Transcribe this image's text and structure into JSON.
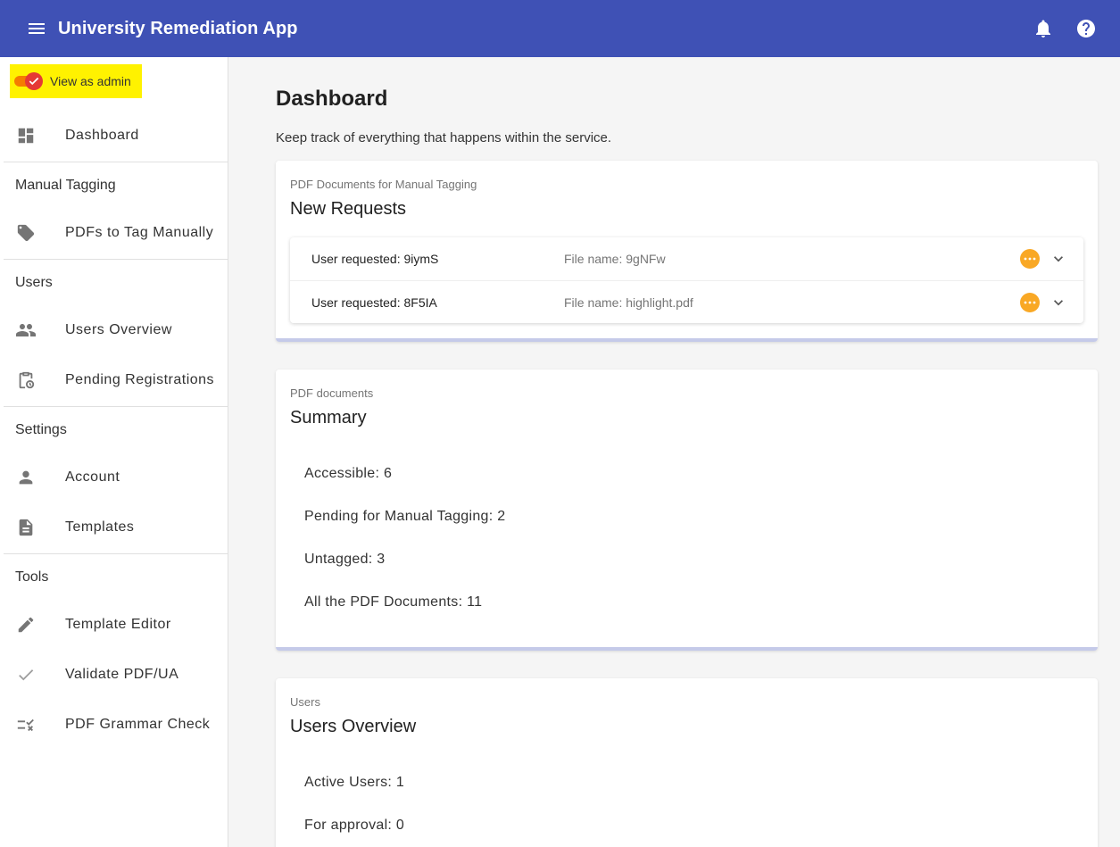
{
  "appbar": {
    "title": "University Remediation App",
    "menu_icon": "menu-icon",
    "notifications_icon": "bell-icon",
    "help_icon": "help-icon",
    "color": "#3f51b5"
  },
  "sidebar": {
    "admin_toggle": {
      "label": "View as admin",
      "checked": true,
      "highlight": "#fff200"
    },
    "items": [
      {
        "label": "Dashboard",
        "icon": "dashboard-icon"
      },
      {
        "section": "Manual Tagging"
      },
      {
        "label": "PDFs to Tag Manually",
        "icon": "tag-icon"
      },
      {
        "section": "Users"
      },
      {
        "label": "Users Overview",
        "icon": "people-icon"
      },
      {
        "label": "Pending Registrations",
        "icon": "clipboard-clock-icon"
      },
      {
        "section": "Settings"
      },
      {
        "label": "Account",
        "icon": "person-icon"
      },
      {
        "label": "Templates",
        "icon": "document-icon"
      },
      {
        "section": "Tools"
      },
      {
        "label": "Template Editor",
        "icon": "pencil-icon"
      },
      {
        "label": "Validate PDF/UA",
        "icon": "check-icon"
      },
      {
        "label": "PDF Grammar Check",
        "icon": "rule-icon"
      }
    ]
  },
  "main": {
    "title": "Dashboard",
    "subtitle": "Keep track of everything that happens within the service.",
    "cards": [
      {
        "overline": "PDF Documents for Manual Tagging",
        "title": "New Requests",
        "requests": [
          {
            "user": "User requested: 9iymS",
            "file": "File name: 9gNFw",
            "status_icon": "pending-icon",
            "expand_icon": "chevron-down-icon"
          },
          {
            "user": "User requested: 8F5IA",
            "file": "File name: highlight.pdf",
            "status_icon": "pending-icon",
            "expand_icon": "chevron-down-icon"
          }
        ]
      },
      {
        "overline": "PDF documents",
        "title": "Summary",
        "stats": [
          "Accessible: 6",
          "Pending for Manual Tagging: 2",
          "Untagged: 3",
          "All the PDF Documents: 11"
        ]
      },
      {
        "overline": "Users",
        "title": "Users Overview",
        "stats": [
          "Active Users: 1",
          "For approval: 0"
        ]
      }
    ],
    "colors": {
      "pending": "#f9a825",
      "card_accent": "#c5cae9"
    }
  }
}
